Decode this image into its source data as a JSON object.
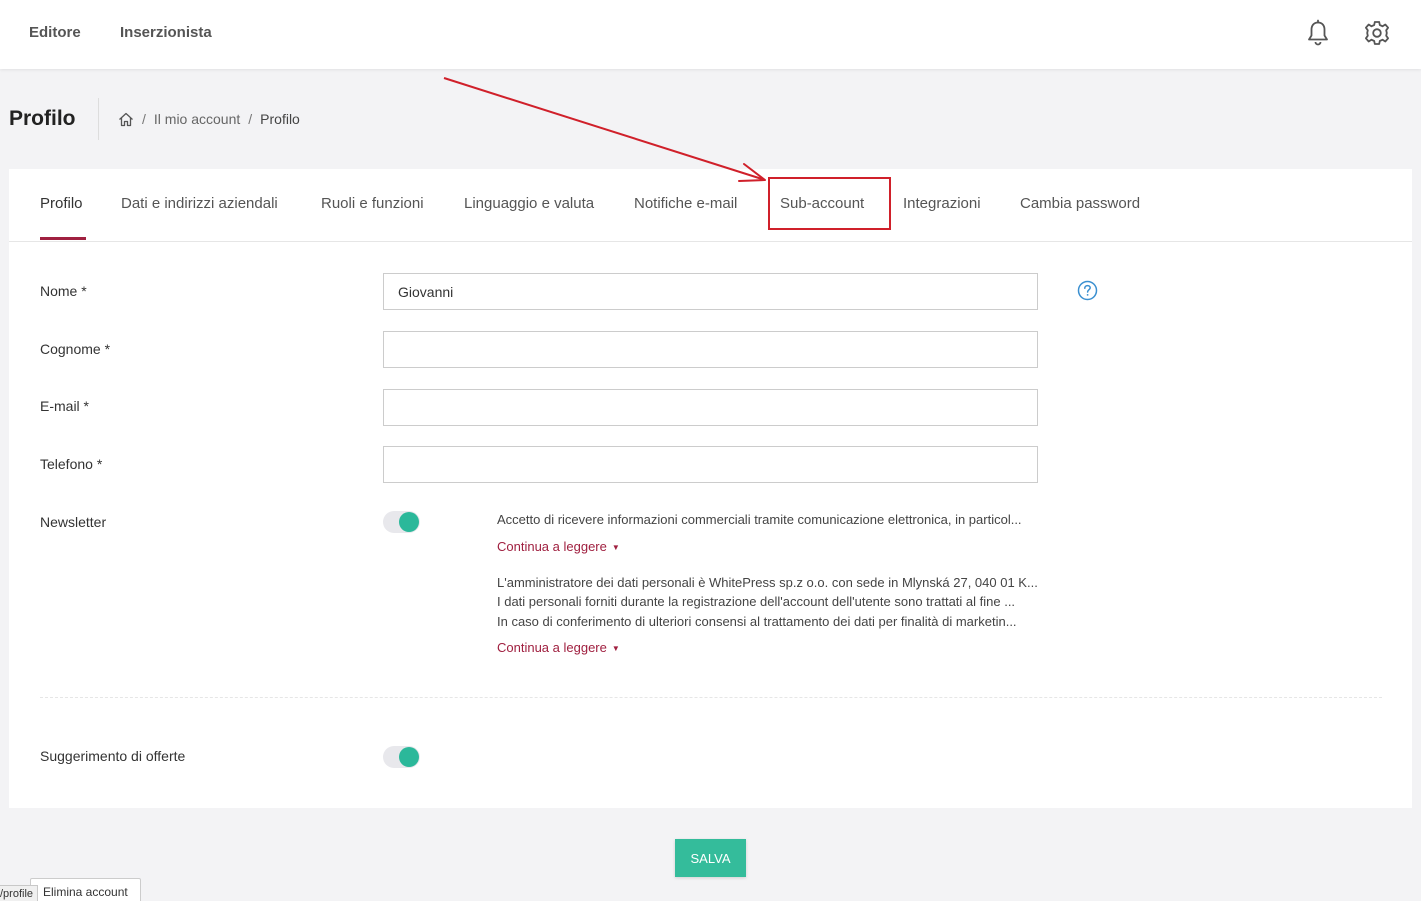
{
  "topbar": {
    "nav": [
      "Editore",
      "Inserzionista"
    ],
    "notifications_icon": "bell-icon",
    "settings_icon": "gear-icon"
  },
  "header": {
    "title": "Profilo",
    "breadcrumb": {
      "home_icon": "home-icon",
      "items": [
        "Il mio account",
        "Profilo"
      ],
      "separator": "/"
    }
  },
  "tabs": [
    {
      "label": "Profilo",
      "active": true
    },
    {
      "label": "Dati e indirizzi aziendali"
    },
    {
      "label": "Ruoli e funzioni"
    },
    {
      "label": "Linguaggio e valuta"
    },
    {
      "label": "Notifiche e-mail"
    },
    {
      "label": "Sub-account",
      "highlighted": true
    },
    {
      "label": "Integrazioni"
    },
    {
      "label": "Cambia password"
    }
  ],
  "form": {
    "fields": [
      {
        "label": "Nome *",
        "value": "Giovanni"
      },
      {
        "label": "Cognome *",
        "value": ""
      },
      {
        "label": "E-mail *",
        "value": ""
      },
      {
        "label": "Telefono *",
        "value": ""
      }
    ],
    "help_icon": "question-circle-icon",
    "newsletter": {
      "label": "Newsletter",
      "enabled": true,
      "consent_text": "Accetto di ricevere informazioni commerciali tramite comunicazione elettronica, in particol...",
      "read_more": "Continua a leggere",
      "privacy_lines": [
        "L'amministratore dei dati personali è WhitePress sp.z o.o. con sede in Mlynská 27, 040 01 K...",
        "I dati personali forniti durante la registrazione dell'account dell'utente sono trattati al fine ...",
        "In caso di conferimento di ulteriori consensi al trattamento dei dati per finalità di marketin..."
      ],
      "privacy_read_more": "Continua a leggere"
    },
    "offers": {
      "label": "Suggerimento di offerte",
      "enabled": true
    }
  },
  "actions": {
    "save": "SALVA",
    "delete": "Elimina account"
  },
  "status_bar": "/profile",
  "colors": {
    "accent": "#a02040",
    "toggle_on": "#2bb89a",
    "save_button": "#34bc9b",
    "annotation": "#d0202a",
    "help_icon": "#3a8fd0"
  }
}
